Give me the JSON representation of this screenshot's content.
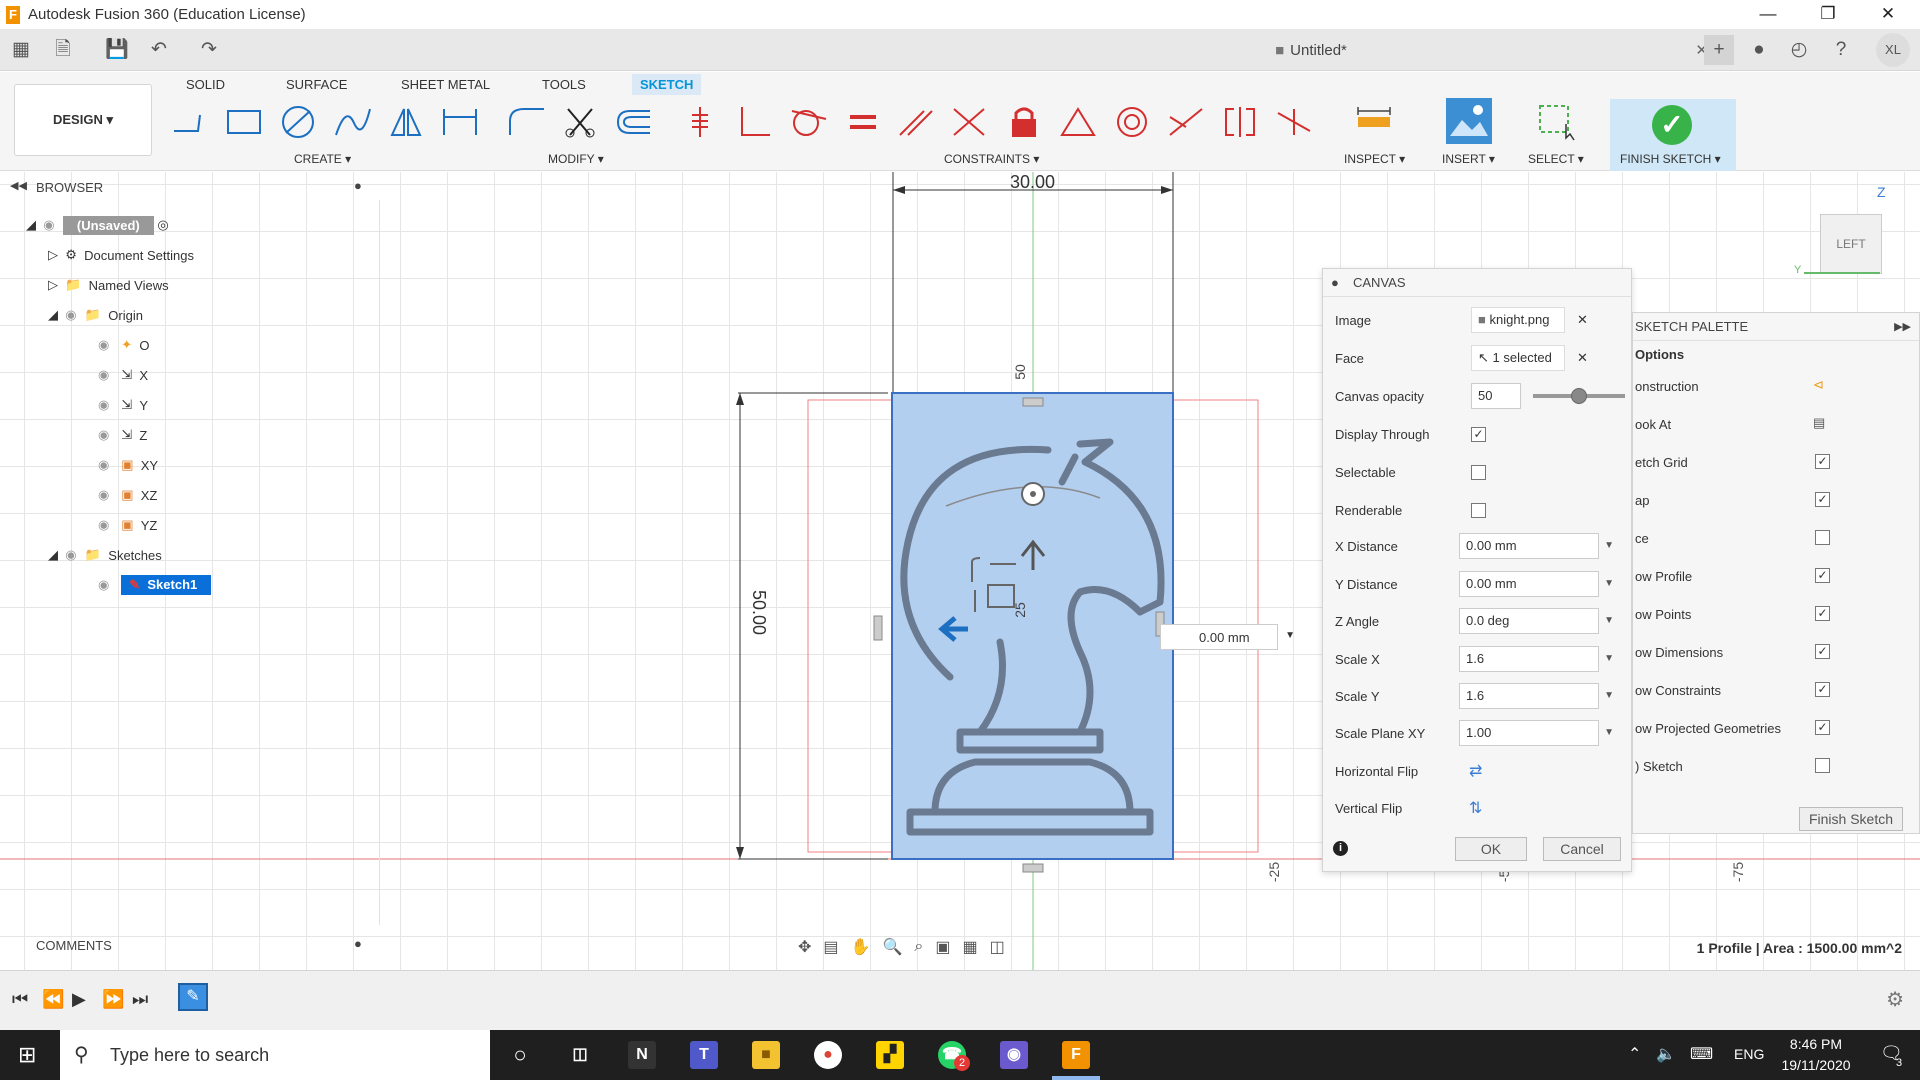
{
  "window": {
    "title": "Autodesk Fusion 360 (Education License)",
    "icon": "F"
  },
  "document": {
    "tab_title": "Untitled*",
    "user_initials": "XL"
  },
  "ribbon": {
    "design_label": "DESIGN",
    "tabs": [
      "SOLID",
      "SURFACE",
      "SHEET METAL",
      "TOOLS",
      "SKETCH"
    ],
    "active_tab": "SKETCH",
    "groups": {
      "create": "CREATE",
      "modify": "MODIFY",
      "constraints": "CONSTRAINTS",
      "inspect": "INSPECT",
      "insert": "INSERT",
      "select": "SELECT",
      "finish": "FINISH SKETCH"
    }
  },
  "browser": {
    "title": "BROWSER",
    "root": "(Unsaved)",
    "items": [
      "Document Settings",
      "Named Views",
      "Origin",
      "O",
      "X",
      "Y",
      "Z",
      "XY",
      "XZ",
      "YZ",
      "Sketches",
      "Sketch1"
    ]
  },
  "comments_label": "COMMENTS",
  "viewcube": {
    "face": "LEFT",
    "axis_z": "Z",
    "axis_y": "Y"
  },
  "dimensions": {
    "width": "30.00",
    "height": "50.00",
    "tick_top": "50",
    "tick_mid": "25",
    "distance_input": "0.00 mm"
  },
  "axis_ticks": [
    "-25",
    "-50",
    "-75"
  ],
  "canvas_panel": {
    "title": "CANVAS",
    "image_label": "Image",
    "image_value": "knight.png",
    "face_label": "Face",
    "face_value": "1 selected",
    "opacity_label": "Canvas opacity",
    "opacity_value": "50",
    "opacity_fraction": 0.5,
    "display_through_label": "Display Through",
    "display_through": true,
    "selectable_label": "Selectable",
    "selectable": false,
    "renderable_label": "Renderable",
    "renderable": false,
    "x_distance_label": "X Distance",
    "x_distance": "0.00 mm",
    "y_distance_label": "Y Distance",
    "y_distance": "0.00 mm",
    "z_angle_label": "Z Angle",
    "z_angle": "0.0 deg",
    "scale_x_label": "Scale X",
    "scale_x": "1.6",
    "scale_y_label": "Scale Y",
    "scale_y": "1.6",
    "scale_plane_label": "Scale Plane XY",
    "scale_plane": "1.00",
    "hflip_label": "Horizontal Flip",
    "vflip_label": "Vertical Flip",
    "ok": "OK",
    "cancel": "Cancel"
  },
  "sketch_palette": {
    "title": "SKETCH PALETTE",
    "options_label": "Options",
    "rows": [
      {
        "label": "onstruction",
        "type": "icon"
      },
      {
        "label": "ook At",
        "type": "icon"
      },
      {
        "label": "etch Grid",
        "checked": true
      },
      {
        "label": "ap",
        "checked": true
      },
      {
        "label": "ce",
        "checked": false
      },
      {
        "label": "ow Profile",
        "checked": true
      },
      {
        "label": "ow Points",
        "checked": true
      },
      {
        "label": "ow Dimensions",
        "checked": true
      },
      {
        "label": "ow Constraints",
        "checked": true
      },
      {
        "label": "ow Projected Geometries",
        "checked": true
      },
      {
        "label": ") Sketch",
        "checked": false
      }
    ],
    "finish_button": "Finish Sketch"
  },
  "status": {
    "profile_info": "1 Profile | Area : 1500.00 mm^2"
  },
  "taskbar": {
    "search_placeholder": "Type here to search",
    "language": "ENG",
    "time": "8:46 PM",
    "date": "19/11/2020",
    "notification_count": "2",
    "action_center_count": "3"
  }
}
